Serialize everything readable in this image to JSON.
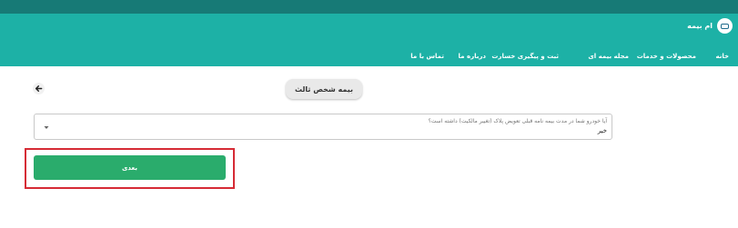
{
  "header": {
    "brand": "ام بیمه",
    "nav": [
      "خانه",
      "محصولات و خدمات",
      "مجله بیمه ای",
      "ثبت و پیگیری خسارت",
      "درباره ما",
      "تماس با ما"
    ]
  },
  "page": {
    "title": "بیمه شخص ثالث"
  },
  "form": {
    "question_label": "آیا خودرو شما در مدت بیمه نامه قبلی تعویض پلاک (تغییر مالکیت) داشته است؟",
    "selected_value": "خیر",
    "next_label": "بعدی"
  },
  "colors": {
    "header_top": "#177a76",
    "header": "#1db1a6",
    "button": "#2aac6c",
    "highlight": "#d62b35"
  }
}
